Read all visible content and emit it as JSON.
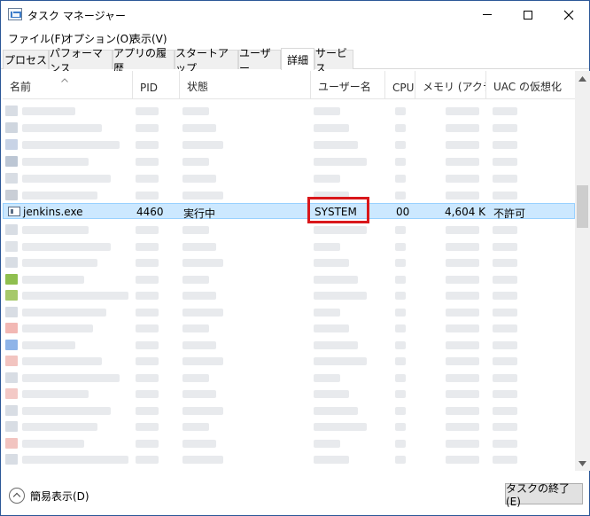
{
  "window": {
    "title": "タスク マネージャー"
  },
  "menu": [
    "ファイル(F)",
    "オプション(O)",
    "表示(V)"
  ],
  "tabs": [
    "プロセス",
    "パフォーマンス",
    "アプリの履歴",
    "スタートアップ",
    "ユーザー",
    "詳細",
    "サービス"
  ],
  "active_tab": "詳細",
  "table": {
    "columns": [
      "名前",
      "PID",
      "状態",
      "ユーザー名",
      "CPU",
      "メモリ (アクテ...",
      "UAC の仮想化"
    ],
    "selected_row": {
      "name": "jenkins.exe",
      "pid": "4460",
      "status": "実行中",
      "user": "SYSTEM",
      "cpu": "00",
      "memory": "4,604 K",
      "uac": "不許可"
    }
  },
  "footer": {
    "fewer_details": "簡易表示(D)",
    "end_task": "タスクの終了(E)"
  },
  "colors": {
    "selection": "#cce8ff",
    "highlight_box": "#d9171b",
    "title_border": "#2b5797"
  }
}
